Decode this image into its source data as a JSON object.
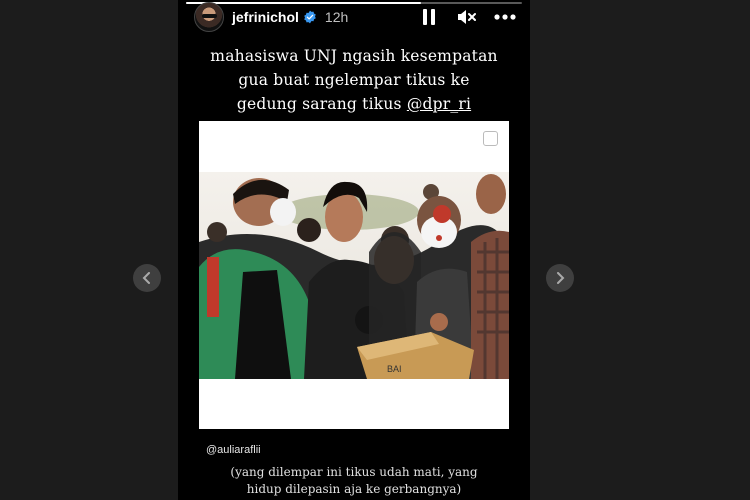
{
  "story": {
    "username": "jefrinichol",
    "time": "12h",
    "caption_lines": [
      "mahasiswa UNJ ngasih kesempatan",
      "gua buat ngelempar tikus ke",
      "gedung sarang tikus "
    ],
    "caption_mention": "@dpr_ri",
    "credit": "@auliaraflii",
    "footnote_lines": [
      "(yang dilempar ini tikus udah mati, yang",
      "hidup dilepasin aja ke gerbangnya)"
    ],
    "progress": 0.7
  },
  "photo": {
    "box_text": "BAI"
  },
  "icons": {
    "verified": "verified-badge-icon",
    "pause": "pause-icon",
    "mute": "muted-speaker-icon",
    "more": "more-options-icon",
    "prev": "chevron-left-icon",
    "next": "chevron-right-icon"
  },
  "colors": {
    "story_bg": "#000000",
    "page_bg": "#1c1c1c",
    "verified_blue": "#3897f0"
  }
}
